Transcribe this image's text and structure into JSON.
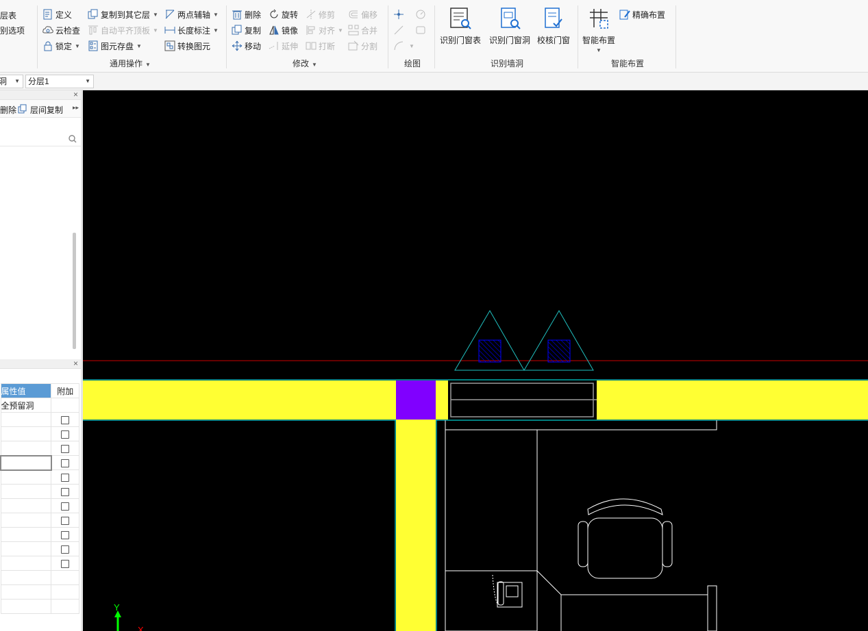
{
  "ribbon": {
    "left_items": {
      "layer_table": "层表",
      "recognize_options": "别选项"
    },
    "general_group": {
      "label": "通用操作",
      "define": "定义",
      "cloud_check": "云检查",
      "lock": "锁定",
      "copy_to_layer": "复制到其它层",
      "auto_align": "自动平齐顶板",
      "element_store": "图元存盘",
      "two_point_axis": "两点辅轴",
      "length_dim": "长度标注",
      "convert_element": "转换图元"
    },
    "modify_group": {
      "label": "修改",
      "delete": "删除",
      "copy": "复制",
      "move": "移动",
      "rotate": "旋转",
      "mirror": "镜像",
      "extend": "延伸",
      "trim": "修剪",
      "align": "对齐",
      "break": "打断",
      "offset": "偏移",
      "merge": "合并",
      "split": "分割"
    },
    "draw_group": {
      "label": "绘图"
    },
    "recognize_wall_opening_group": {
      "label": "识别墙洞",
      "recognize_window_table": "识别门窗表",
      "recognize_door_opening": "识别门窗洞",
      "check_doors_windows": "校核门窗"
    },
    "smart_layout_group": {
      "label": "智能布置",
      "smart_layout": "智能布置",
      "precise_layout": "精确布置"
    }
  },
  "layerbar": {
    "type_select": "洞",
    "layer_select": "分层1"
  },
  "left_panel": {
    "toolbar": {
      "delete": "删除",
      "copy_between_floors": "层间复制"
    },
    "properties": {
      "header_value": "属性值",
      "header_extra": "附加",
      "first_value": "全预留洞"
    }
  },
  "colors": {
    "wall_fill": "#ffff33",
    "column_fill": "#8000ff",
    "wall_outline": "#00ffff",
    "ref_line": "#cc0000",
    "triangle": "#20c0c0",
    "hatch": "#0000ff",
    "furniture_line": "#ffffff",
    "axis_y": "#00ff00",
    "axis_x": "#ff0000"
  },
  "canvas": {
    "axis_y_label": "Y",
    "axis_x_label": "X"
  }
}
